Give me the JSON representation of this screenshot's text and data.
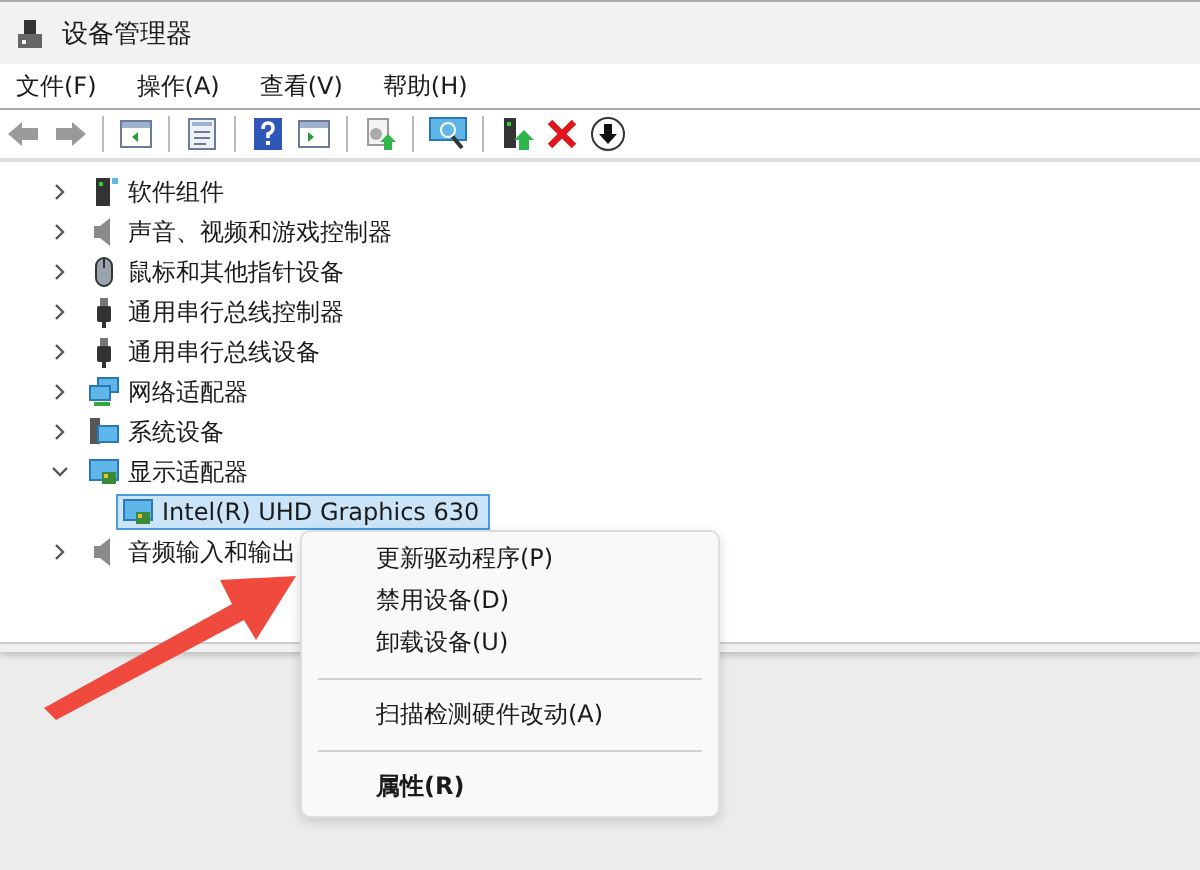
{
  "window": {
    "title": "设备管理器"
  },
  "menu_bar": [
    {
      "label": "文件(F)"
    },
    {
      "label": "操作(A)"
    },
    {
      "label": "查看(V)"
    },
    {
      "label": "帮助(H)"
    }
  ],
  "toolbar": [
    {
      "kind": "back",
      "disabled": true
    },
    {
      "kind": "forward",
      "disabled": true
    },
    {
      "kind": "separator"
    },
    {
      "kind": "panel"
    },
    {
      "kind": "separator"
    },
    {
      "kind": "properties"
    },
    {
      "kind": "separator"
    },
    {
      "kind": "help"
    },
    {
      "kind": "panel2"
    },
    {
      "kind": "separator"
    },
    {
      "kind": "scan"
    },
    {
      "kind": "separator"
    },
    {
      "kind": "monitor"
    },
    {
      "kind": "separator"
    },
    {
      "kind": "update"
    },
    {
      "kind": "remove"
    },
    {
      "kind": "download"
    }
  ],
  "tree": [
    {
      "label": "软件组件",
      "kind": "software",
      "expanded": false
    },
    {
      "label": "声音、视频和游戏控制器",
      "kind": "speaker",
      "expanded": false
    },
    {
      "label": "鼠标和其他指针设备",
      "kind": "mouse",
      "expanded": false
    },
    {
      "label": "通用串行总线控制器",
      "kind": "usb",
      "expanded": false
    },
    {
      "label": "通用串行总线设备",
      "kind": "usb",
      "expanded": false
    },
    {
      "label": "网络适配器",
      "kind": "network",
      "expanded": false
    },
    {
      "label": "系统设备",
      "kind": "system",
      "expanded": false
    },
    {
      "label": "显示适配器",
      "kind": "display",
      "expanded": true,
      "children": [
        {
          "label": "Intel(R) UHD Graphics 630",
          "kind": "display",
          "selected": true
        }
      ]
    },
    {
      "label": "音频输入和输出",
      "kind": "speaker",
      "expanded": false
    }
  ],
  "context_menu": [
    {
      "kind": "item",
      "label": "更新驱动程序(P)",
      "bold": false
    },
    {
      "kind": "item",
      "label": "禁用设备(D)",
      "bold": false
    },
    {
      "kind": "item",
      "label": "卸载设备(U)",
      "bold": false
    },
    {
      "kind": "separator"
    },
    {
      "kind": "item",
      "label": "扫描检测硬件改动(A)",
      "bold": false
    },
    {
      "kind": "separator"
    },
    {
      "kind": "item",
      "label": "属性(R)",
      "bold": true
    }
  ]
}
